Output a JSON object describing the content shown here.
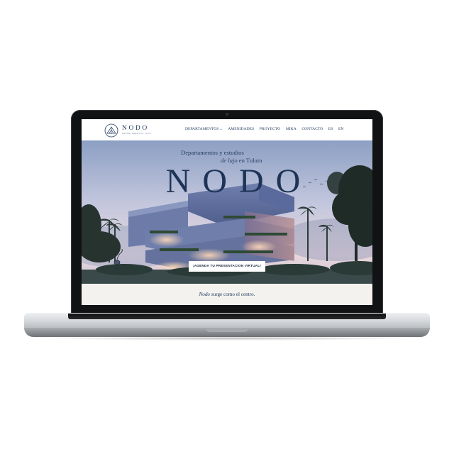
{
  "site": {
    "logo": {
      "word": "NODO",
      "subtitle": "DEPARTAMENTOS LUJO"
    },
    "nav": {
      "items": [
        {
          "label": "DEPARTAMENTOS",
          "dropdown": true
        },
        {
          "label": "AMENIDADES",
          "dropdown": false
        },
        {
          "label": "PROYECTO",
          "dropdown": false
        },
        {
          "label": "MIKA",
          "dropdown": false
        },
        {
          "label": "CONTACTO",
          "dropdown": false
        }
      ],
      "languages": [
        "ES",
        "EN"
      ],
      "caret": "⌄"
    },
    "hero": {
      "line1": "Departamentos y estudios",
      "line2_em": "de lujo",
      "line2_rest": " en Tulum",
      "title": "NODO",
      "cta": "¡AGENDA TU PRESENTACION VIRTUAL!"
    },
    "intro": {
      "em": "Nodo",
      "rest": " surge como el centro."
    }
  },
  "colors": {
    "brand_navy": "#1f3a5c",
    "sky_top": "#8ea1c4",
    "sky_bottom": "#e9d9de",
    "building": "#5a6b9a",
    "bezel": "#111214"
  }
}
